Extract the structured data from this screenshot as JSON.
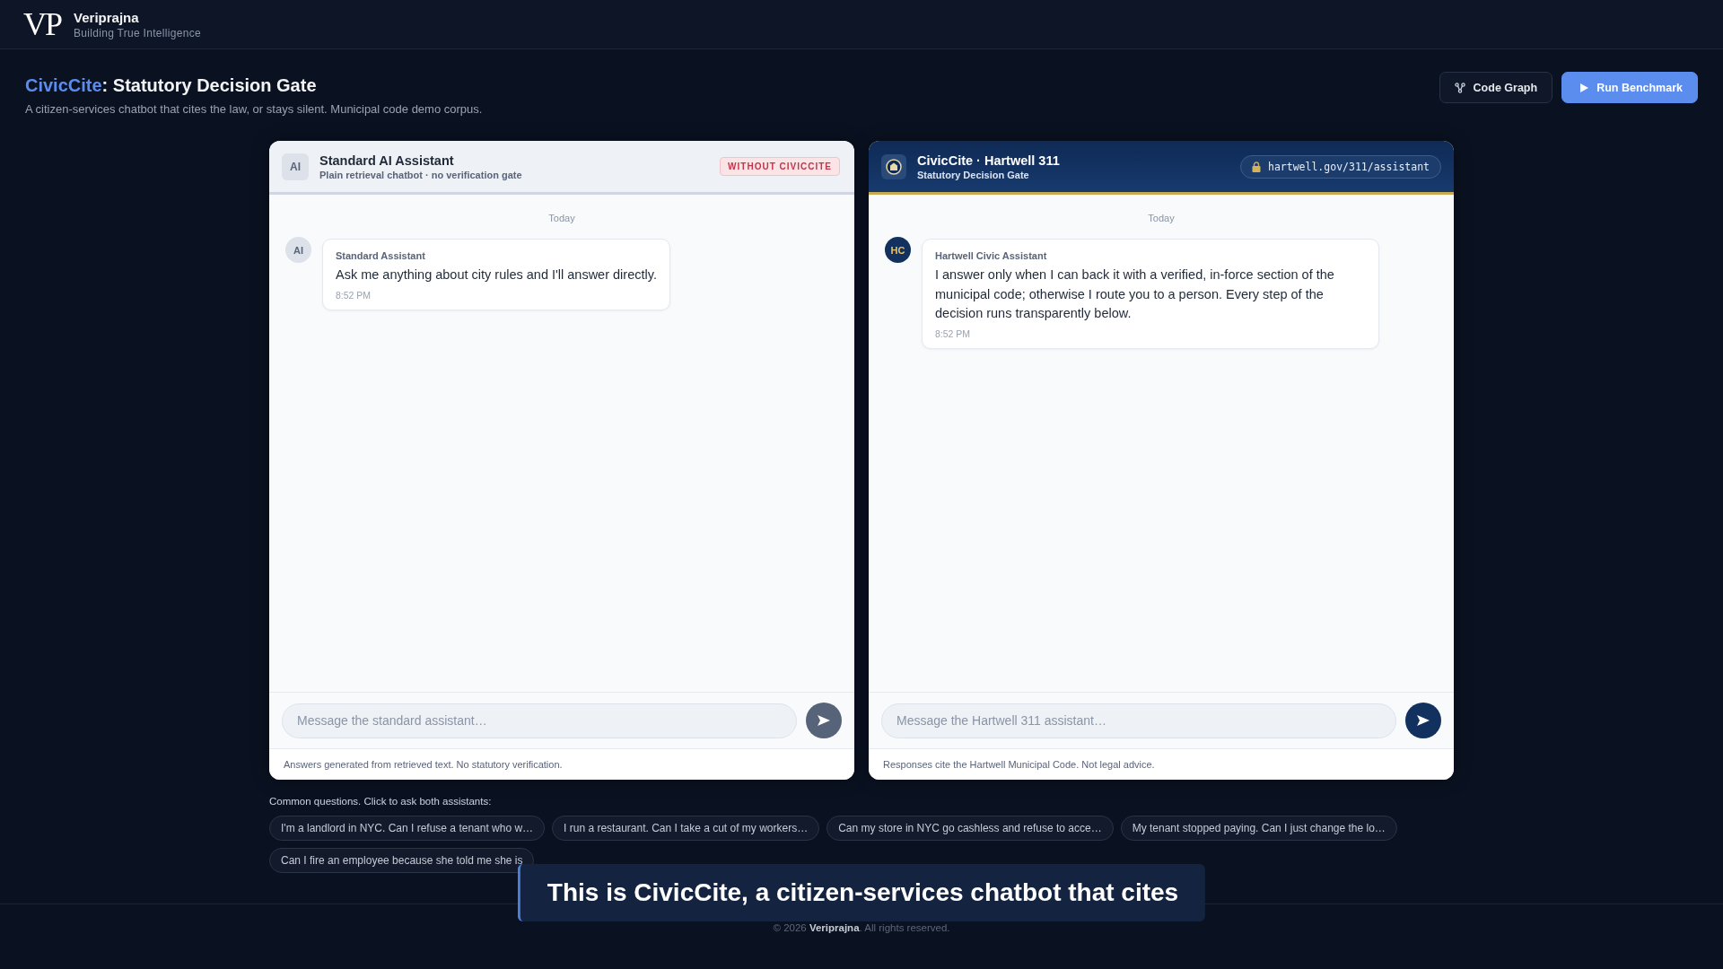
{
  "brand": {
    "logo": "VP",
    "name": "Veriprajna",
    "tagline": "Building True Intelligence"
  },
  "page": {
    "title_brand": "CivicCite",
    "title": ": Statutory Decision Gate",
    "subtitle": "A citizen-services chatbot that cites the law, or stays silent. Municipal code demo corpus."
  },
  "actions": [
    {
      "label": "Code Graph",
      "kind": "secondary"
    },
    {
      "label": "Run Benchmark",
      "kind": "primary"
    }
  ],
  "panels": [
    {
      "kind": "standard",
      "avatar": "AI",
      "title": "Standard AI Assistant",
      "subtitle": "Plain retrieval chatbot · no verification gate",
      "badge": "WITHOUT CIVICCITE",
      "day": "Today",
      "messages": [
        {
          "avatar": "AI",
          "sender": "Standard Assistant",
          "text": "Ask me anything about city rules and I'll answer directly.",
          "time": "8:52 PM"
        }
      ],
      "placeholder": "Message the standard assistant…",
      "footer": "Answers generated from retrieved text. No statutory verification."
    },
    {
      "kind": "civic",
      "title": "CivicCite · Hartwell 311",
      "subtitle": "Statutory Decision Gate",
      "url": "hartwell.gov/311/assistant",
      "day": "Today",
      "messages": [
        {
          "avatar": "HC",
          "sender": "Hartwell Civic Assistant",
          "text": "I answer only when I can back it with a verified, in-force section of the municipal code; otherwise I route you to a person. Every step of the decision runs transparently below.",
          "time": "8:52 PM"
        }
      ],
      "placeholder": "Message the Hartwell 311 assistant…",
      "footer": "Responses cite the Hartwell Municipal Code. Not legal advice."
    }
  ],
  "questions": {
    "label": "Common questions. Click to ask both assistants:",
    "items": [
      "I'm a landlord in NYC. Can I refuse a tenant who w…",
      "I run a restaurant. Can I take a cut of my workers…",
      "Can my store in NYC go cashless and refuse to acce…",
      "My tenant stopped paying. Can I just change the lo…",
      "Can I fire an employee because she told me she is"
    ]
  },
  "caption": "This is CivicCite, a citizen-services chatbot that cites",
  "footer": "© 2026 **Veriprajna**. All rights reserved."
}
